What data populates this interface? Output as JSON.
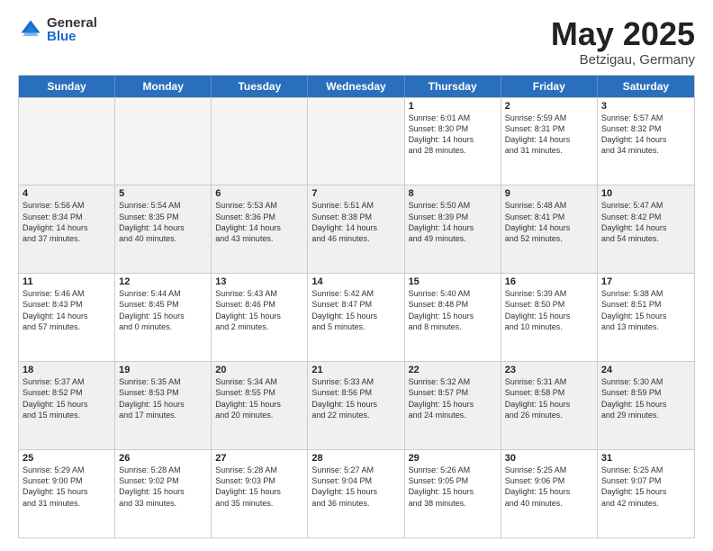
{
  "logo": {
    "general": "General",
    "blue": "Blue"
  },
  "title": {
    "month": "May 2025",
    "location": "Betzigau, Germany"
  },
  "days": [
    "Sunday",
    "Monday",
    "Tuesday",
    "Wednesday",
    "Thursday",
    "Friday",
    "Saturday"
  ],
  "rows": [
    [
      {
        "day": "",
        "text": "",
        "empty": true
      },
      {
        "day": "",
        "text": "",
        "empty": true
      },
      {
        "day": "",
        "text": "",
        "empty": true
      },
      {
        "day": "",
        "text": "",
        "empty": true
      },
      {
        "day": "1",
        "text": "Sunrise: 6:01 AM\nSunset: 8:30 PM\nDaylight: 14 hours\nand 28 minutes."
      },
      {
        "day": "2",
        "text": "Sunrise: 5:59 AM\nSunset: 8:31 PM\nDaylight: 14 hours\nand 31 minutes."
      },
      {
        "day": "3",
        "text": "Sunrise: 5:57 AM\nSunset: 8:32 PM\nDaylight: 14 hours\nand 34 minutes."
      }
    ],
    [
      {
        "day": "4",
        "text": "Sunrise: 5:56 AM\nSunset: 8:34 PM\nDaylight: 14 hours\nand 37 minutes."
      },
      {
        "day": "5",
        "text": "Sunrise: 5:54 AM\nSunset: 8:35 PM\nDaylight: 14 hours\nand 40 minutes."
      },
      {
        "day": "6",
        "text": "Sunrise: 5:53 AM\nSunset: 8:36 PM\nDaylight: 14 hours\nand 43 minutes."
      },
      {
        "day": "7",
        "text": "Sunrise: 5:51 AM\nSunset: 8:38 PM\nDaylight: 14 hours\nand 46 minutes."
      },
      {
        "day": "8",
        "text": "Sunrise: 5:50 AM\nSunset: 8:39 PM\nDaylight: 14 hours\nand 49 minutes."
      },
      {
        "day": "9",
        "text": "Sunrise: 5:48 AM\nSunset: 8:41 PM\nDaylight: 14 hours\nand 52 minutes."
      },
      {
        "day": "10",
        "text": "Sunrise: 5:47 AM\nSunset: 8:42 PM\nDaylight: 14 hours\nand 54 minutes."
      }
    ],
    [
      {
        "day": "11",
        "text": "Sunrise: 5:46 AM\nSunset: 8:43 PM\nDaylight: 14 hours\nand 57 minutes."
      },
      {
        "day": "12",
        "text": "Sunrise: 5:44 AM\nSunset: 8:45 PM\nDaylight: 15 hours\nand 0 minutes."
      },
      {
        "day": "13",
        "text": "Sunrise: 5:43 AM\nSunset: 8:46 PM\nDaylight: 15 hours\nand 2 minutes."
      },
      {
        "day": "14",
        "text": "Sunrise: 5:42 AM\nSunset: 8:47 PM\nDaylight: 15 hours\nand 5 minutes."
      },
      {
        "day": "15",
        "text": "Sunrise: 5:40 AM\nSunset: 8:48 PM\nDaylight: 15 hours\nand 8 minutes."
      },
      {
        "day": "16",
        "text": "Sunrise: 5:39 AM\nSunset: 8:50 PM\nDaylight: 15 hours\nand 10 minutes."
      },
      {
        "day": "17",
        "text": "Sunrise: 5:38 AM\nSunset: 8:51 PM\nDaylight: 15 hours\nand 13 minutes."
      }
    ],
    [
      {
        "day": "18",
        "text": "Sunrise: 5:37 AM\nSunset: 8:52 PM\nDaylight: 15 hours\nand 15 minutes."
      },
      {
        "day": "19",
        "text": "Sunrise: 5:35 AM\nSunset: 8:53 PM\nDaylight: 15 hours\nand 17 minutes."
      },
      {
        "day": "20",
        "text": "Sunrise: 5:34 AM\nSunset: 8:55 PM\nDaylight: 15 hours\nand 20 minutes."
      },
      {
        "day": "21",
        "text": "Sunrise: 5:33 AM\nSunset: 8:56 PM\nDaylight: 15 hours\nand 22 minutes."
      },
      {
        "day": "22",
        "text": "Sunrise: 5:32 AM\nSunset: 8:57 PM\nDaylight: 15 hours\nand 24 minutes."
      },
      {
        "day": "23",
        "text": "Sunrise: 5:31 AM\nSunset: 8:58 PM\nDaylight: 15 hours\nand 26 minutes."
      },
      {
        "day": "24",
        "text": "Sunrise: 5:30 AM\nSunset: 8:59 PM\nDaylight: 15 hours\nand 29 minutes."
      }
    ],
    [
      {
        "day": "25",
        "text": "Sunrise: 5:29 AM\nSunset: 9:00 PM\nDaylight: 15 hours\nand 31 minutes."
      },
      {
        "day": "26",
        "text": "Sunrise: 5:28 AM\nSunset: 9:02 PM\nDaylight: 15 hours\nand 33 minutes."
      },
      {
        "day": "27",
        "text": "Sunrise: 5:28 AM\nSunset: 9:03 PM\nDaylight: 15 hours\nand 35 minutes."
      },
      {
        "day": "28",
        "text": "Sunrise: 5:27 AM\nSunset: 9:04 PM\nDaylight: 15 hours\nand 36 minutes."
      },
      {
        "day": "29",
        "text": "Sunrise: 5:26 AM\nSunset: 9:05 PM\nDaylight: 15 hours\nand 38 minutes."
      },
      {
        "day": "30",
        "text": "Sunrise: 5:25 AM\nSunset: 9:06 PM\nDaylight: 15 hours\nand 40 minutes."
      },
      {
        "day": "31",
        "text": "Sunrise: 5:25 AM\nSunset: 9:07 PM\nDaylight: 15 hours\nand 42 minutes."
      }
    ]
  ]
}
